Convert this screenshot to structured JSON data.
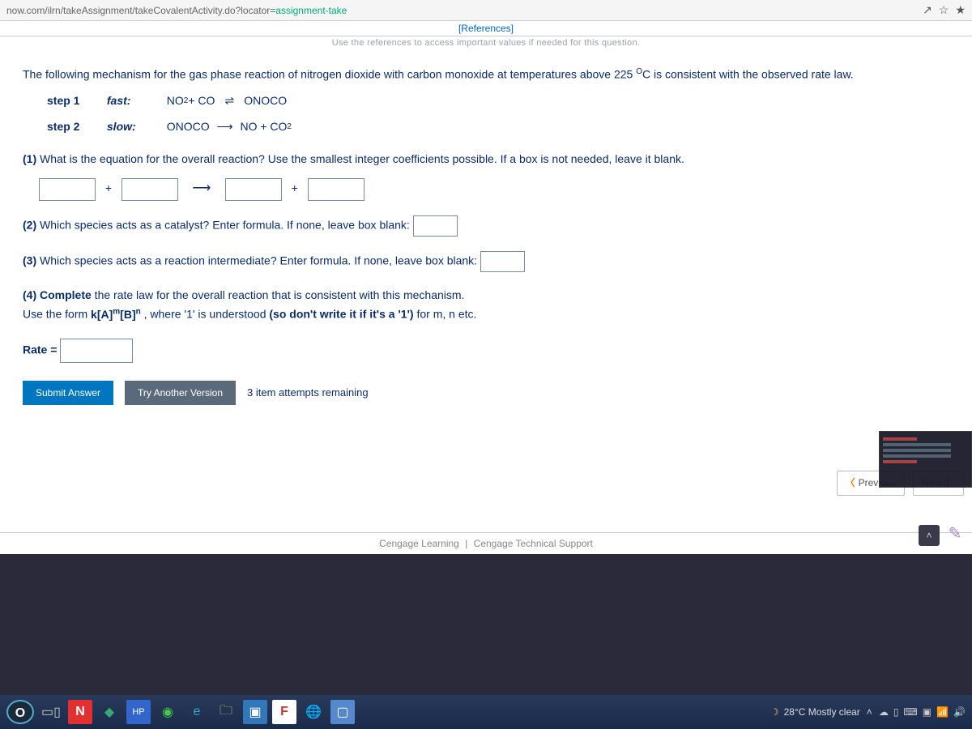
{
  "url": {
    "prefix": "now.com/ilrn/takeAssignment/takeCovalentActivity.do?locator=",
    "highlight": "assignment-take"
  },
  "references_label": "[References]",
  "obscured": "Use the references to access important values if needed for this question.",
  "intro": {
    "line1_a": "The following mechanism for the gas phase reaction of nitrogen dioxide with carbon monoxide at temperatures above 225 ",
    "line1_deg": "O",
    "line1_b": "C is consistent with the observed rate law."
  },
  "steps": {
    "s1_label": "step 1",
    "s1_speed": "fast:",
    "s1_lhs_a": "NO",
    "s1_lhs_sub": "2",
    "s1_lhs_b": " + CO",
    "s1_rhs": "ONOCO",
    "s2_label": "step 2",
    "s2_speed": "slow:",
    "s2_lhs": "ONOCO",
    "s2_rhs_a": "NO + CO",
    "s2_rhs_sub": "2"
  },
  "q1": {
    "num": "(1)",
    "text": " What is the equation for the overall reaction? Use the smallest integer coefficients possible. If a box is not needed, leave it blank.",
    "plus": "+",
    "arrow": "⟶"
  },
  "q2": {
    "num": "(2)",
    "text": "  Which species acts as a catalyst? Enter formula. If none, leave box blank:"
  },
  "q3": {
    "num": "(3)",
    "text": "  Which species acts as a reaction intermediate? Enter formula. If none, leave box blank:"
  },
  "q4": {
    "num": "(4) Complete",
    "text_a": " the rate law for the overall reaction that is consistent with this mechanism.",
    "text_b": "Use the form ",
    "rate_form_a": "k[A]",
    "rate_form_m": "m",
    "rate_form_b": "[B]",
    "rate_form_n": "n",
    "text_c": " , where '1' is understood ",
    "text_d": "(so don't write it if it's a '1')",
    "text_e": " for m, n etc.",
    "rate_label": "Rate ="
  },
  "buttons": {
    "submit": "Submit Answer",
    "try": "Try Another Version",
    "attempts": "3 item attempts remaining",
    "prev": "Previous",
    "next": "Next"
  },
  "footer": {
    "a": "Cengage Learning",
    "b": "Cengage Technical Support"
  },
  "taskbar": {
    "weather": "28°C  Mostly clear"
  }
}
